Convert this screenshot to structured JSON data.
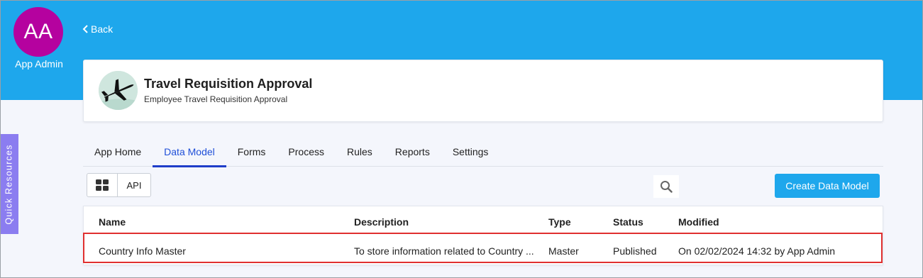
{
  "user": {
    "initials": "AA",
    "name": "App Admin",
    "avatar_color": "#b5029f"
  },
  "nav": {
    "back_label": "Back"
  },
  "app": {
    "title": "Travel Requisition Approval",
    "subtitle": "Employee Travel Requisition Approval",
    "icon": "airplane-icon"
  },
  "sidebar": {
    "quick_resources_label": "Quick Resources"
  },
  "tabs": [
    {
      "label": "App Home"
    },
    {
      "label": "Data Model",
      "active": true
    },
    {
      "label": "Forms"
    },
    {
      "label": "Process"
    },
    {
      "label": "Rules"
    },
    {
      "label": "Reports"
    },
    {
      "label": "Settings"
    }
  ],
  "toolbar": {
    "view_icon": "grid-view-icon",
    "api_label": "API",
    "search_icon": "search-icon",
    "create_label": "Create Data Model"
  },
  "table": {
    "columns": [
      "Name",
      "Description",
      "Type",
      "Status",
      "Modified"
    ],
    "rows": [
      [
        "Country Info Master",
        "To store information related to Country ...",
        "Master",
        "Published",
        "On 02/02/2024 14:32 by App Admin"
      ]
    ]
  },
  "colors": {
    "accent": "#1ea7ec",
    "quick_resources": "#8b7df0",
    "active_tab": "#1f3ec9",
    "highlight": "#e03030"
  }
}
